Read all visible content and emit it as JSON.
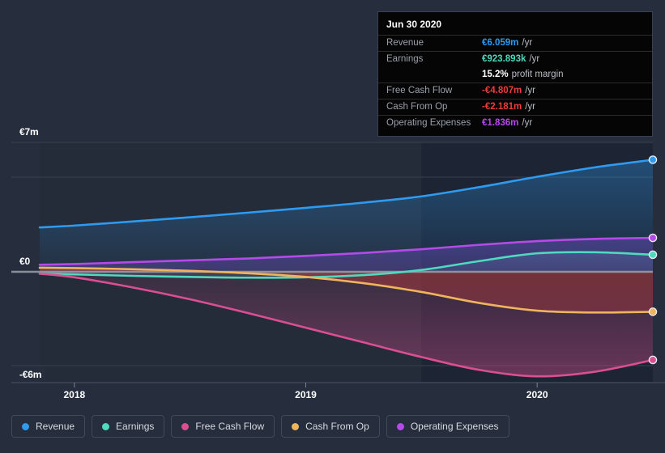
{
  "theme": {
    "background": "#262e3d",
    "plot_background": "#242b39",
    "forecast_background": "#1d2433",
    "gridline": "#39404f",
    "zero_line": "#9aa0ab",
    "axis_text": "#ffffff"
  },
  "tooltip": {
    "title": "Jun 30 2020",
    "rows": [
      {
        "label": "Revenue",
        "value": "€6.059m",
        "unit": "/yr",
        "color": "#2e9bf0"
      },
      {
        "label": "Earnings",
        "value": "€923.893k",
        "unit": "/yr",
        "color": "#4fd9bf"
      },
      {
        "label": "",
        "value": "15.2%",
        "unit": "profit margin",
        "color": "#ffffff"
      },
      {
        "label": "Free Cash Flow",
        "value": "-€4.807m",
        "unit": "/yr",
        "color": "#ee3b3b"
      },
      {
        "label": "Cash From Op",
        "value": "-€2.181m",
        "unit": "/yr",
        "color": "#ee3b3b"
      },
      {
        "label": "Operating Expenses",
        "value": "€1.836m",
        "unit": "/yr",
        "color": "#b44ae8"
      }
    ]
  },
  "legend": {
    "items": [
      {
        "label": "Revenue",
        "color": "#2e9bf0"
      },
      {
        "label": "Earnings",
        "color": "#4fd9bf"
      },
      {
        "label": "Free Cash Flow",
        "color": "#d94f91"
      },
      {
        "label": "Cash From Op",
        "color": "#efb45e"
      },
      {
        "label": "Operating Expenses",
        "color": "#b44ae8"
      }
    ]
  },
  "chart_data": {
    "type": "area",
    "title": "",
    "xlabel": "",
    "ylabel": "",
    "currency": "EUR",
    "units": "millions",
    "ylim": [
      -6,
      7
    ],
    "y_ticks": [
      7,
      0,
      -6
    ],
    "y_tick_labels": [
      "€7m",
      "€0",
      "-€6m"
    ],
    "grid": true,
    "legend_position": "bottom",
    "x_ticks": [
      2018,
      2019,
      2020
    ],
    "x_tick_labels": [
      "2018",
      "2019",
      "2020"
    ],
    "x_range": [
      2017.85,
      2020.5
    ],
    "forecast_start": 2019.5,
    "x": [
      2017.85,
      2018.0,
      2018.25,
      2018.5,
      2018.75,
      2019.0,
      2019.25,
      2019.5,
      2019.75,
      2020.0,
      2020.25,
      2020.5
    ],
    "series": [
      {
        "name": "Revenue",
        "color": "#2e9bf0",
        "values": [
          2.4,
          2.5,
          2.72,
          2.95,
          3.2,
          3.46,
          3.74,
          4.08,
          4.58,
          5.14,
          5.65,
          6.059
        ],
        "end_value": 6.059,
        "end_label": "€6.059m"
      },
      {
        "name": "Earnings",
        "color": "#4fd9bf",
        "values": [
          -0.1,
          -0.14,
          -0.22,
          -0.28,
          -0.32,
          -0.3,
          -0.18,
          0.1,
          0.58,
          1.0,
          1.06,
          0.924
        ],
        "end_value": 0.924,
        "end_label": "€923.893k"
      },
      {
        "name": "Free Cash Flow",
        "color": "#d94f91",
        "values": [
          -0.1,
          -0.3,
          -0.85,
          -1.5,
          -2.25,
          -3.05,
          -3.85,
          -4.65,
          -5.35,
          -5.7,
          -5.45,
          -4.807
        ],
        "end_value": -4.807,
        "end_label": "-€4.807m"
      },
      {
        "name": "Cash From Op",
        "color": "#efb45e",
        "values": [
          0.22,
          0.2,
          0.14,
          0.05,
          -0.08,
          -0.28,
          -0.62,
          -1.1,
          -1.7,
          -2.12,
          -2.22,
          -2.181
        ],
        "end_value": -2.181,
        "end_label": "-€2.181m"
      },
      {
        "name": "Operating Expenses",
        "color": "#b44ae8",
        "values": [
          0.38,
          0.42,
          0.52,
          0.62,
          0.72,
          0.86,
          1.02,
          1.22,
          1.46,
          1.66,
          1.78,
          1.836
        ],
        "end_value": 1.836,
        "end_label": "€1.836m"
      }
    ]
  }
}
